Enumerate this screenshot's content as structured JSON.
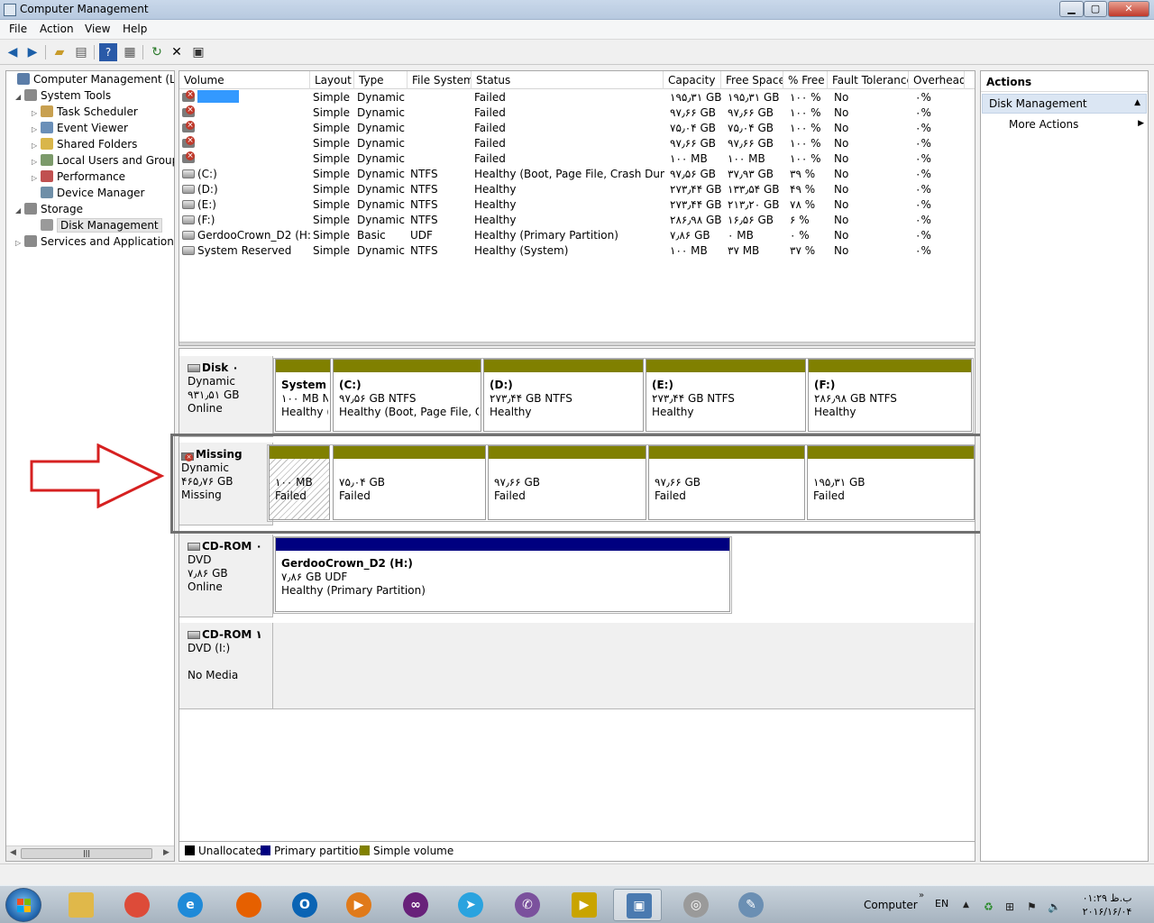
{
  "window": {
    "title": "Computer Management"
  },
  "menu": [
    "File",
    "Action",
    "View",
    "Help"
  ],
  "toolbar": {
    "icons": [
      "back-arrow-icon",
      "forward-arrow-icon",
      "up-folder-icon",
      "show-hide-tree-icon",
      "help-icon",
      "properties-icon",
      "refresh-icon",
      "delete-icon",
      "export-icon"
    ]
  },
  "tree": [
    {
      "label": "Computer Management (Local",
      "level": 0,
      "twisty": "",
      "icon": "computer-icon",
      "color": "#5b7da8"
    },
    {
      "label": "System Tools",
      "level": 1,
      "twisty": "◢",
      "icon": "tools-icon",
      "color": "#8a8a8a"
    },
    {
      "label": "Task Scheduler",
      "level": 2,
      "twisty": "▷",
      "icon": "clock-icon",
      "color": "#c8a050"
    },
    {
      "label": "Event Viewer",
      "level": 2,
      "twisty": "▷",
      "icon": "event-viewer-icon",
      "color": "#6a8fb8"
    },
    {
      "label": "Shared Folders",
      "level": 2,
      "twisty": "▷",
      "icon": "shared-folder-icon",
      "color": "#d9b64a"
    },
    {
      "label": "Local Users and Groups",
      "level": 2,
      "twisty": "▷",
      "icon": "users-icon",
      "color": "#7c9a6a"
    },
    {
      "label": "Performance",
      "level": 2,
      "twisty": "▷",
      "icon": "performance-icon",
      "color": "#c05050"
    },
    {
      "label": "Device Manager",
      "level": 2,
      "twisty": "",
      "icon": "device-manager-icon",
      "color": "#6f8fa8"
    },
    {
      "label": "Storage",
      "level": 1,
      "twisty": "◢",
      "icon": "storage-icon",
      "color": "#8a8a8a"
    },
    {
      "label": "Disk Management",
      "level": 2,
      "twisty": "",
      "icon": "disk-icon",
      "color": "#9a9a9a",
      "selected": true
    },
    {
      "label": "Services and Applications",
      "level": 1,
      "twisty": "▷",
      "icon": "services-icon",
      "color": "#8a8a8a"
    }
  ],
  "volumes": {
    "columns": [
      "Volume",
      "Layout",
      "Type",
      "File System",
      "Status",
      "Capacity",
      "Free Space",
      "% Free",
      "Fault Tolerance",
      "Overhead"
    ],
    "rows": [
      {
        "volume": "",
        "state": "failed",
        "highlight": true,
        "layout": "Simple",
        "type": "Dynamic",
        "fs": "",
        "status": "Failed",
        "capacity": "۱۹۵٫۳۱ GB",
        "free": "۱۹۵٫۳۱ GB",
        "pct": "۱۰۰ %",
        "fault": "No",
        "overhead": "۰%"
      },
      {
        "volume": "",
        "state": "failed",
        "layout": "Simple",
        "type": "Dynamic",
        "fs": "",
        "status": "Failed",
        "capacity": "۹۷٫۶۶ GB",
        "free": "۹۷٫۶۶ GB",
        "pct": "۱۰۰ %",
        "fault": "No",
        "overhead": "۰%"
      },
      {
        "volume": "",
        "state": "failed",
        "layout": "Simple",
        "type": "Dynamic",
        "fs": "",
        "status": "Failed",
        "capacity": "۷۵٫۰۴ GB",
        "free": "۷۵٫۰۴ GB",
        "pct": "۱۰۰ %",
        "fault": "No",
        "overhead": "۰%"
      },
      {
        "volume": "",
        "state": "failed",
        "layout": "Simple",
        "type": "Dynamic",
        "fs": "",
        "status": "Failed",
        "capacity": "۹۷٫۶۶ GB",
        "free": "۹۷٫۶۶ GB",
        "pct": "۱۰۰ %",
        "fault": "No",
        "overhead": "۰%"
      },
      {
        "volume": "",
        "state": "failed",
        "layout": "Simple",
        "type": "Dynamic",
        "fs": "",
        "status": "Failed",
        "capacity": "۱۰۰ MB",
        "free": "۱۰۰ MB",
        "pct": "۱۰۰ %",
        "fault": "No",
        "overhead": "۰%"
      },
      {
        "volume": "(C:)",
        "state": "ok",
        "layout": "Simple",
        "type": "Dynamic",
        "fs": "NTFS",
        "status": "Healthy (Boot, Page File, Crash Dump)",
        "capacity": "۹۷٫۵۶ GB",
        "free": "۳۷٫۹۳ GB",
        "pct": "۳۹ %",
        "fault": "No",
        "overhead": "۰%"
      },
      {
        "volume": "(D:)",
        "state": "ok",
        "layout": "Simple",
        "type": "Dynamic",
        "fs": "NTFS",
        "status": "Healthy",
        "capacity": "۲۷۳٫۴۴ GB",
        "free": "۱۳۳٫۵۴ GB",
        "pct": "۴۹ %",
        "fault": "No",
        "overhead": "۰%"
      },
      {
        "volume": "(E:)",
        "state": "ok",
        "layout": "Simple",
        "type": "Dynamic",
        "fs": "NTFS",
        "status": "Healthy",
        "capacity": "۲۷۳٫۴۴ GB",
        "free": "۲۱۳٫۲۰ GB",
        "pct": "۷۸ %",
        "fault": "No",
        "overhead": "۰%"
      },
      {
        "volume": "(F:)",
        "state": "ok",
        "layout": "Simple",
        "type": "Dynamic",
        "fs": "NTFS",
        "status": "Healthy",
        "capacity": "۲۸۶٫۹۸ GB",
        "free": "۱۶٫۵۶ GB",
        "pct": "۶ %",
        "fault": "No",
        "overhead": "۰%"
      },
      {
        "volume": "GerdooCrown_D2 (H:)",
        "state": "ok",
        "layout": "Simple",
        "type": "Basic",
        "fs": "UDF",
        "status": "Healthy (Primary Partition)",
        "capacity": "۷٫۸۶ GB",
        "free": "۰ MB",
        "pct": "۰ %",
        "fault": "No",
        "overhead": "۰%"
      },
      {
        "volume": "System Reserved",
        "state": "ok",
        "layout": "Simple",
        "type": "Dynamic",
        "fs": "NTFS",
        "status": "Healthy (System)",
        "capacity": "۱۰۰ MB",
        "free": "۳۷ MB",
        "pct": "۳۷ %",
        "fault": "No",
        "overhead": "۰%"
      }
    ]
  },
  "disks": [
    {
      "name": "Disk ۰",
      "line2": "Dynamic",
      "line3": "۹۳۱٫۵۱ GB",
      "line4": "Online",
      "icon": "disk",
      "parts": [
        {
          "name": "System R",
          "size": "۱۰۰ MB N",
          "status": "Healthy (S",
          "bar": "#808000"
        },
        {
          "name": "(C:)",
          "size": "۹۷٫۵۶ GB NTFS",
          "status": "Healthy (Boot, Page File, Cra",
          "bar": "#808000"
        },
        {
          "name": "(D:)",
          "size": "۲۷۳٫۴۴ GB NTFS",
          "status": "Healthy",
          "bar": "#808000"
        },
        {
          "name": "(E:)",
          "size": "۲۷۳٫۴۴ GB NTFS",
          "status": "Healthy",
          "bar": "#808000"
        },
        {
          "name": "(F:)",
          "size": "۲۸۶٫۹۸ GB NTFS",
          "status": "Healthy",
          "bar": "#808000"
        }
      ]
    },
    {
      "name": "Missing",
      "line2": "Dynamic",
      "line3": "۴۶۵٫۷۶ GB",
      "line4": "Missing",
      "icon": "missing",
      "parts": [
        {
          "name": "",
          "size": "۱۰۰ MB",
          "status": "Failed",
          "bar": "#808000",
          "hatched": true
        },
        {
          "name": "",
          "size": "۷۵٫۰۴ GB",
          "status": "Failed",
          "bar": "#808000"
        },
        {
          "name": "",
          "size": "۹۷٫۶۶ GB",
          "status": "Failed",
          "bar": "#808000"
        },
        {
          "name": "",
          "size": "۹۷٫۶۶ GB",
          "status": "Failed",
          "bar": "#808000"
        },
        {
          "name": "",
          "size": "۱۹۵٫۳۱ GB",
          "status": "Failed",
          "bar": "#808000"
        }
      ]
    },
    {
      "name": "CD-ROM ۰",
      "line2": "DVD",
      "line3": "۷٫۸۶ GB",
      "line4": "Online",
      "icon": "cdrom",
      "parts": [
        {
          "name": "GerdooCrown_D2  (H:)",
          "size": "۷٫۸۶ GB UDF",
          "status": "Healthy (Primary Partition)",
          "bar": "#000080"
        }
      ]
    },
    {
      "name": "CD-ROM ۱",
      "line2": "DVD (I:)",
      "line3": "",
      "line4": "No Media",
      "icon": "cdrom",
      "parts": []
    }
  ],
  "legend": [
    {
      "label": "Unallocated",
      "color": "#000000"
    },
    {
      "label": "Primary partition",
      "color": "#000080"
    },
    {
      "label": "Simple volume",
      "color": "#808000"
    }
  ],
  "actions": {
    "header": "Actions",
    "section": "Disk Management",
    "item": "More Actions"
  },
  "taskbar": {
    "apps": [
      {
        "name": "explorer-icon",
        "glyph": "",
        "color": "#e0b84a"
      },
      {
        "name": "chrome-icon",
        "glyph": "",
        "color": "#dd4b39"
      },
      {
        "name": "internet-explorer-icon",
        "glyph": "e",
        "color": "#1f8ad8"
      },
      {
        "name": "firefox-icon",
        "glyph": "",
        "color": "#e66000"
      },
      {
        "name": "outlook-icon",
        "glyph": "O",
        "color": "#0a64b4"
      },
      {
        "name": "media-player-icon",
        "glyph": "▶",
        "color": "#e07a1a"
      },
      {
        "name": "visual-studio-icon",
        "glyph": "∞",
        "color": "#68217a"
      },
      {
        "name": "telegram-icon",
        "glyph": "➤",
        "color": "#2aa3df"
      },
      {
        "name": "viber-icon",
        "glyph": "✆",
        "color": "#7b519d"
      },
      {
        "name": "kmplayer-icon",
        "glyph": "▶",
        "color": "#c9a400"
      },
      {
        "name": "computer-management-icon",
        "glyph": "▣",
        "color": "#4a7ab0",
        "active": true
      },
      {
        "name": "dvd-icon",
        "glyph": "◎",
        "color": "#9a9a9a"
      },
      {
        "name": "tool-icon",
        "glyph": "✎",
        "color": "#6b8fb3"
      }
    ],
    "computer": "Computer",
    "lang": "EN",
    "time": "ب.ظ ۰۱:۲۹",
    "date": "۲۰۱۶/۱۶/۰۴"
  }
}
